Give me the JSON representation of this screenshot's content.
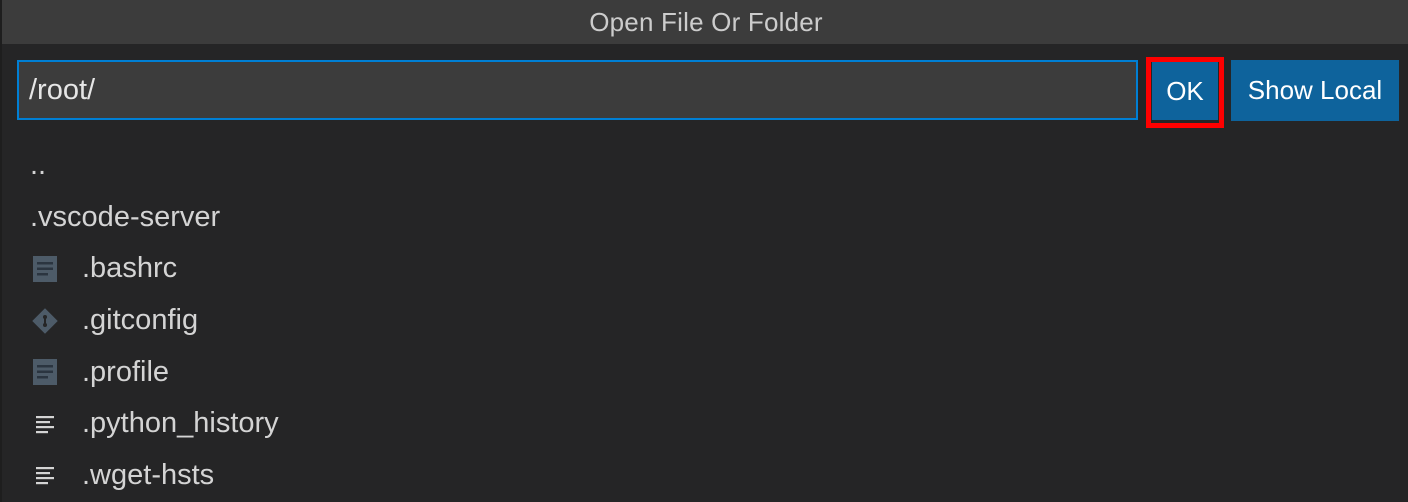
{
  "dialog": {
    "title": "Open File Or Folder"
  },
  "path_input": {
    "value": "/root/"
  },
  "buttons": {
    "ok_label": "OK",
    "show_local_label": "Show Local"
  },
  "entries": [
    {
      "name": "..",
      "kind": "parent",
      "icon": ""
    },
    {
      "name": ".vscode-server",
      "kind": "folder",
      "icon": ""
    },
    {
      "name": ".bashrc",
      "kind": "file",
      "icon": "document-icon"
    },
    {
      "name": ".gitconfig",
      "kind": "file",
      "icon": "git-icon"
    },
    {
      "name": ".profile",
      "kind": "file",
      "icon": "document-icon"
    },
    {
      "name": ".python_history",
      "kind": "file",
      "icon": "text-lines-icon"
    },
    {
      "name": ".wget-hsts",
      "kind": "file",
      "icon": "text-lines-icon"
    }
  ],
  "colors": {
    "accent": "#0e639c",
    "focus_border": "#007fd4",
    "highlight_box": "#ff0000"
  }
}
